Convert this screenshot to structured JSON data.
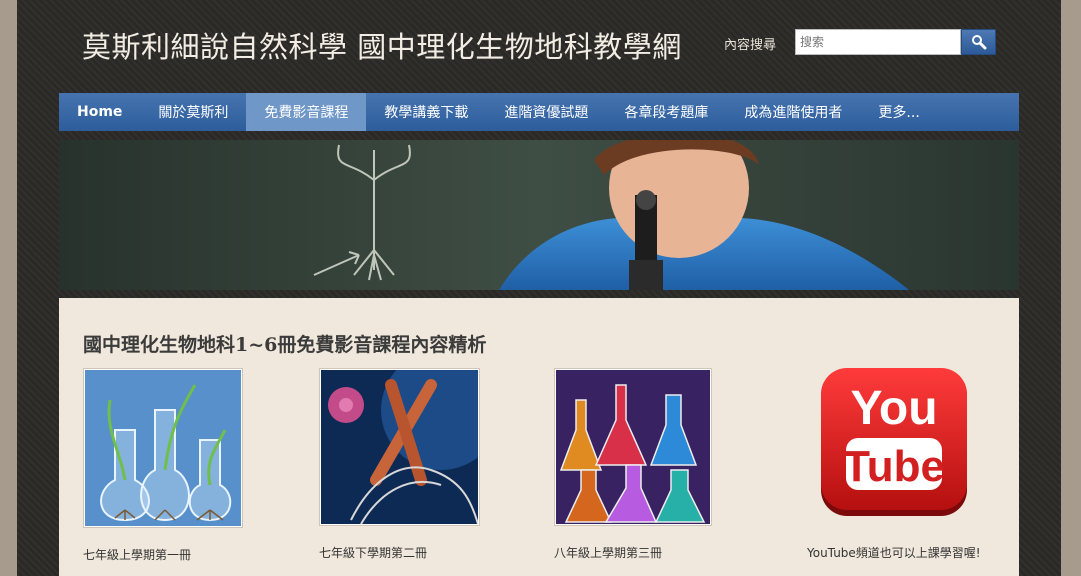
{
  "header": {
    "site_title": "莫斯利細說自然科學 國中理化生物地科教學網",
    "search_label": "內容搜尋",
    "search_placeholder": "搜索"
  },
  "nav": {
    "items": [
      {
        "label": "Home"
      },
      {
        "label": "關於莫斯利"
      },
      {
        "label": "免費影音課程"
      },
      {
        "label": "教學講義下載"
      },
      {
        "label": "進階資優試題"
      },
      {
        "label": "各章段考題庫"
      },
      {
        "label": "成為進階使用者"
      },
      {
        "label": "更多..."
      }
    ],
    "active_index": 2
  },
  "main": {
    "heading": "國中理化生物地科1~6冊免費影音課程內容精析",
    "cards": [
      {
        "caption": "七年級上學期第一冊",
        "image": "plant-flasks-image"
      },
      {
        "caption": "七年級下學期第二冊",
        "image": "chromosome-dna-image"
      },
      {
        "caption": "八年級上學期第三冊",
        "image": "chemistry-flasks-image"
      },
      {
        "caption": "YouTube頻道也可以上課學習喔!",
        "image": "youtube-logo"
      }
    ],
    "youtube_logo_text": {
      "line1": "You",
      "line2": "Tube"
    }
  },
  "colors": {
    "nav": "#3566a6",
    "nav_active": "#6f97c7",
    "content_bg": "#f0e8dc",
    "youtube_red": "#d21f1f"
  }
}
